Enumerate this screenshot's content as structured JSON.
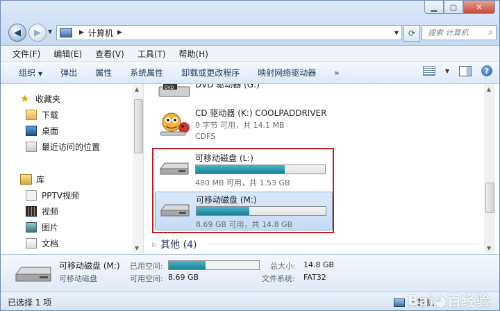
{
  "window": {
    "breadcrumb": "计算机",
    "search_placeholder": "搜索 计算机"
  },
  "menu": [
    "文件(F)",
    "编辑(E)",
    "查看(V)",
    "工具(T)",
    "帮助(H)"
  ],
  "toolbar": {
    "organize": "组织",
    "eject": "弹出",
    "properties": "属性",
    "system_properties": "系统属性",
    "uninstall": "卸载或更改程序",
    "map_drive": "映射网络驱动器",
    "more": "»"
  },
  "nav": {
    "favorites": "收藏夹",
    "downloads": "下载",
    "desktop": "桌面",
    "recent": "最近访问的位置",
    "libraries": "库",
    "pptv": "PPTV视频",
    "videos": "视频",
    "pictures": "图片",
    "documents": "文档"
  },
  "drives": {
    "dvd": {
      "name": "DVD 驱动器 (G:)"
    },
    "cd": {
      "name": "CD 驱动器 (K:) COOLPADDRIVER",
      "free": "0 字节 可用，共 14.1 MB",
      "fs": "CDFS"
    },
    "l": {
      "name": "可移动磁盘 (L:)",
      "free": "480 MB 可用，共 1.53 GB",
      "used_fraction": 0.69
    },
    "m": {
      "name": "可移动磁盘 (M:)",
      "free": "8.69 GB 可用，共 14.8 GB",
      "used_fraction": 0.41
    }
  },
  "other_group": "其他 (4)",
  "details": {
    "title": "可移动磁盘 (M:)",
    "subtitle": "可移动磁盘",
    "used_label": "已用空间:",
    "free_label": "可用空间:",
    "free_value": "8.69 GB",
    "total_label": "总大小:",
    "total_value": "14.8 GB",
    "fs_label": "文件系统:",
    "fs_value": "FAT32"
  },
  "status": {
    "selection": "已选择 1 项",
    "location": "计算机"
  },
  "colors": {
    "accent": "#1a7f97",
    "highlight_box": "#c0181f"
  }
}
